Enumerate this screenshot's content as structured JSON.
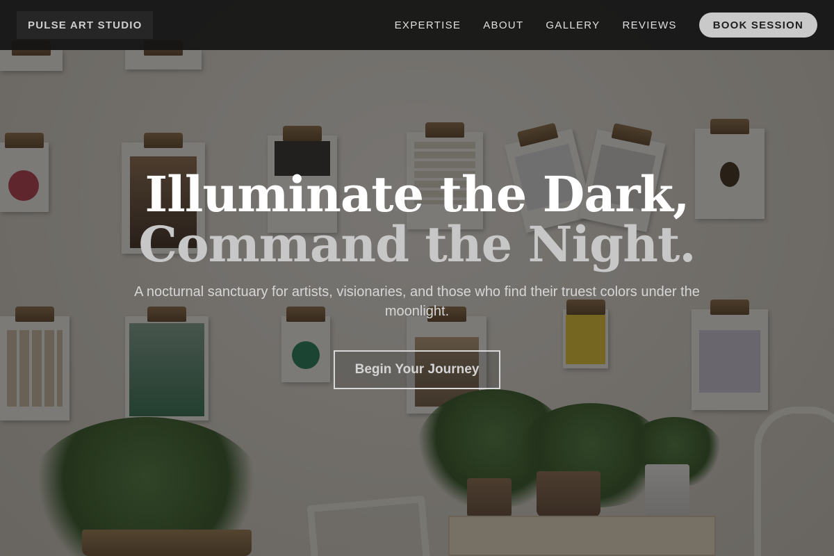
{
  "nav": {
    "logo": "PULSE ART STUDIO",
    "links": [
      "EXPERTISE",
      "ABOUT",
      "GALLERY",
      "REVIEWS"
    ],
    "cta": "BOOK SESSION"
  },
  "hero": {
    "headline_line1": "Illuminate the Dark,",
    "headline_line2": "Command the Night.",
    "tagline": "A nocturnal sanctuary for artists, visionaries, and those who find their truest colors under the moonlight.",
    "button": "Begin Your Journey"
  },
  "colors": {
    "navbar_bg": "#141414",
    "cta_bg": "#c9c9c9",
    "headline_primary": "#ffffff",
    "headline_secondary": "#c7c7c7"
  }
}
